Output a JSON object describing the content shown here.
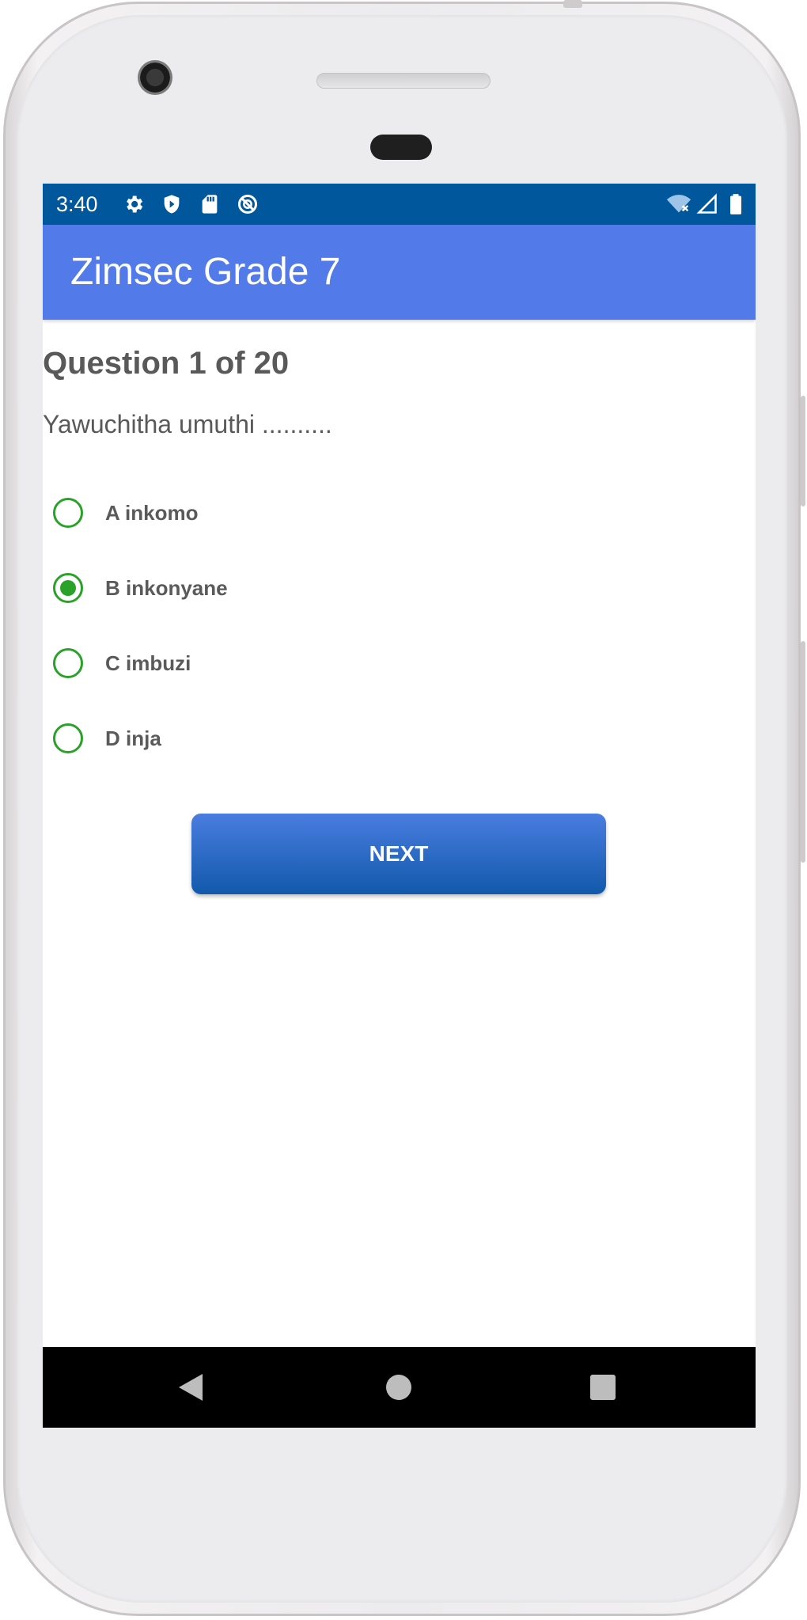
{
  "status_bar": {
    "time": "3:40",
    "left_icons": [
      "gear-icon",
      "shield-icon",
      "sd-card-icon",
      "no-sync-icon"
    ],
    "right_icons": [
      "wifi-off-icon",
      "signal-icon",
      "battery-icon"
    ]
  },
  "app_bar": {
    "title": "Zimsec Grade 7"
  },
  "question": {
    "counter": "Question 1 of 20",
    "text": "Yawuchitha umuthi .........."
  },
  "options": [
    {
      "label": "A inkomo",
      "selected": false
    },
    {
      "label": "B inkonyane",
      "selected": true
    },
    {
      "label": "C imbuzi",
      "selected": false
    },
    {
      "label": "D inja",
      "selected": false
    }
  ],
  "next_button": {
    "label": "NEXT"
  },
  "colors": {
    "status_bar": "#01579b",
    "app_bar": "#527ae8",
    "radio_accent": "#2aa22a",
    "button": "#1159ab"
  },
  "nav_bar": {
    "buttons": [
      "back-icon",
      "home-icon",
      "recents-icon"
    ]
  }
}
